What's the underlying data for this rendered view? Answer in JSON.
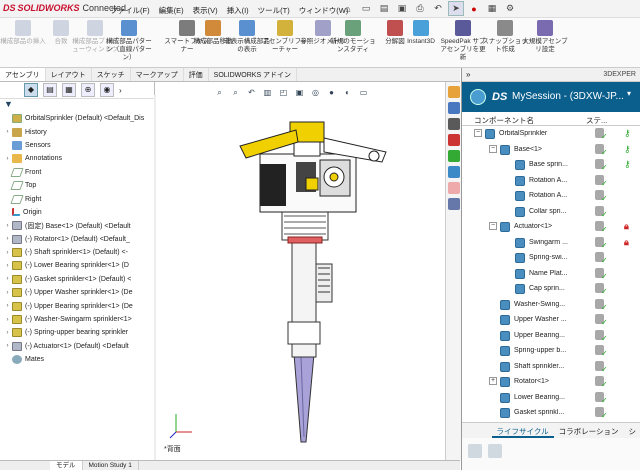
{
  "app": {
    "logo_ds": "DS",
    "logo_text": "SOLIDWORKS",
    "logo_connected": "Connected"
  },
  "menu": [
    "ファイル(F)",
    "編集(E)",
    "表示(V)",
    "挿入(I)",
    "ツール(T)",
    "ウィンドウ(W)"
  ],
  "ribbon": [
    {
      "label": "構成部品の挿入",
      "disabled": true,
      "color": "#9aa9c0"
    },
    {
      "label": "合致",
      "disabled": true,
      "color": "#9aa9c0"
    },
    {
      "label": "構成部品プレビューウィンドウ",
      "disabled": true,
      "color": "#9aa9c0"
    },
    {
      "label": "構成部品パターン（直線パターン）",
      "disabled": false,
      "color": "#5a8fd0"
    },
    {
      "label": "スマートファスナー",
      "disabled": false,
      "color": "#7c7c7c"
    },
    {
      "label": "構成部品移動",
      "disabled": false,
      "color": "#d08a3a"
    },
    {
      "label": "非表示構成部品の表示",
      "disabled": false,
      "color": "#5a8fd0"
    },
    {
      "label": "アセンブリフィーチャー",
      "disabled": false,
      "color": "#d2b23a"
    },
    {
      "label": "参照ジオメトリ",
      "disabled": false,
      "color": "#a0a0c8"
    },
    {
      "label": "新規のモーションスタディ",
      "disabled": false,
      "color": "#6aa07a"
    },
    {
      "label": "分解図",
      "disabled": false,
      "color": "#c05050"
    },
    {
      "label": "Instant3D",
      "disabled": false,
      "color": "#4aa0d8"
    },
    {
      "label": "SpeedPak サブアセンブリを更新",
      "disabled": false,
      "color": "#5a5a9a"
    },
    {
      "label": "スナップショット作成",
      "disabled": false,
      "color": "#8a8a8a"
    },
    {
      "label": "大規模アセンブリ設定",
      "disabled": false,
      "color": "#7a6ab0"
    }
  ],
  "command_tabs": [
    {
      "label": "アセンブリ",
      "active": true
    },
    {
      "label": "レイアウト",
      "active": false
    },
    {
      "label": "スケッチ",
      "active": false
    },
    {
      "label": "マークアップ",
      "active": false
    },
    {
      "label": "評価",
      "active": false
    },
    {
      "label": "SOLIDWORKS アドイン",
      "active": false
    }
  ],
  "feature_tree": {
    "filter_icon": "funnel-icon",
    "items": [
      {
        "label": "OrbitalSprinkler (Default) <Default_Dis",
        "icon": "root",
        "expander": ""
      },
      {
        "label": "History",
        "icon": "folder",
        "expander": "›"
      },
      {
        "label": "Sensors",
        "icon": "sens",
        "expander": ""
      },
      {
        "label": "Annotations",
        "icon": "annot",
        "expander": "›"
      },
      {
        "label": "Front",
        "icon": "plane",
        "expander": ""
      },
      {
        "label": "Top",
        "icon": "plane",
        "expander": ""
      },
      {
        "label": "Right",
        "icon": "plane",
        "expander": ""
      },
      {
        "label": "Origin",
        "icon": "origin",
        "expander": ""
      },
      {
        "label": "(固定) Base<1> (Default) <Default",
        "icon": "asm",
        "expander": "›"
      },
      {
        "label": "(-) Rotator<1> (Default) <Default_",
        "icon": "asm",
        "expander": "›"
      },
      {
        "label": "(-) Shaft sprinkler<1> (Default) <-",
        "icon": "part",
        "expander": "›"
      },
      {
        "label": "(-) Lower Bearing sprinkler<1> (D",
        "icon": "part",
        "expander": "›"
      },
      {
        "label": "(-) Gasket sprinkler<1> (Default) <",
        "icon": "part",
        "expander": "›"
      },
      {
        "label": "(-) Upper Washer sprinkler<1> (De",
        "icon": "part",
        "expander": "›"
      },
      {
        "label": "(-) Upper Bearing sprinkler<1> (De",
        "icon": "part",
        "expander": "›"
      },
      {
        "label": "(-) Washer-Swingarm sprinkler<1>",
        "icon": "part",
        "expander": "›"
      },
      {
        "label": "(-) Spring-upper bearing sprinkler",
        "icon": "part",
        "expander": "›"
      },
      {
        "label": "(-) Actuator<1> (Default) <Default",
        "icon": "asm",
        "expander": "›"
      },
      {
        "label": "Mates",
        "icon": "mates",
        "expander": ""
      }
    ]
  },
  "bottom_tabs": [
    {
      "label": "モデル",
      "active": true
    },
    {
      "label": "Motion Study 1",
      "active": false
    }
  ],
  "viewport": {
    "view_label": "*背面"
  },
  "explorer": {
    "header_name": "3DEXPER",
    "session_ds": "DS",
    "session_title": "MySession - (3DXW-JP...",
    "col_component": "コンポーネント名",
    "col_status": "ステ...",
    "rows": [
      {
        "label": "OrbitalSprinkler",
        "indent": 0,
        "expander": "−",
        "lock": "g"
      },
      {
        "label": "Base<1>",
        "indent": 1,
        "expander": "−",
        "lock": "g"
      },
      {
        "label": "Base sprin...",
        "indent": 2,
        "expander": "",
        "lock": "g"
      },
      {
        "label": "Rotation A...",
        "indent": 2,
        "expander": "",
        "lock": ""
      },
      {
        "label": "Rotation A...",
        "indent": 2,
        "expander": "",
        "lock": ""
      },
      {
        "label": "Collar spri...",
        "indent": 2,
        "expander": "",
        "lock": ""
      },
      {
        "label": "Actuator<1>",
        "indent": 1,
        "expander": "−",
        "lock": "r"
      },
      {
        "label": "Swingarm ...",
        "indent": 2,
        "expander": "",
        "lock": "r"
      },
      {
        "label": "Spring-swi...",
        "indent": 2,
        "expander": "",
        "lock": ""
      },
      {
        "label": "Name Plat...",
        "indent": 2,
        "expander": "",
        "lock": ""
      },
      {
        "label": "Cap sprin...",
        "indent": 2,
        "expander": "",
        "lock": ""
      },
      {
        "label": "Washer-Swing...",
        "indent": 1,
        "expander": "",
        "lock": ""
      },
      {
        "label": "Upper Washer ...",
        "indent": 1,
        "expander": "",
        "lock": ""
      },
      {
        "label": "Upper Bearing...",
        "indent": 1,
        "expander": "",
        "lock": ""
      },
      {
        "label": "Spring-upper b...",
        "indent": 1,
        "expander": "",
        "lock": ""
      },
      {
        "label": "Shaft sprinkler...",
        "indent": 1,
        "expander": "",
        "lock": ""
      },
      {
        "label": "Rotator<1>",
        "indent": 1,
        "expander": "+",
        "lock": ""
      },
      {
        "label": "Lower Bearing...",
        "indent": 1,
        "expander": "",
        "lock": ""
      },
      {
        "label": "Gasket sprinkl...",
        "indent": 1,
        "expander": "",
        "lock": ""
      }
    ],
    "bottom_tabs": [
      {
        "label": "ライフサイクル",
        "active": true
      },
      {
        "label": "コラボレーション",
        "active": false
      },
      {
        "label": "シ",
        "active": false
      }
    ]
  }
}
